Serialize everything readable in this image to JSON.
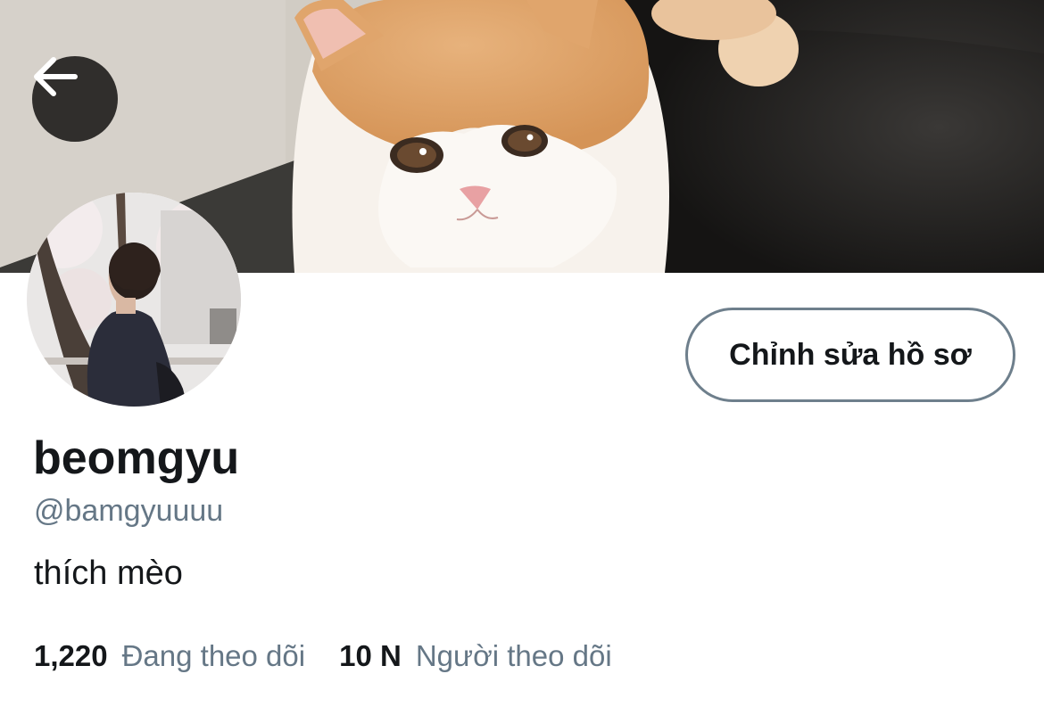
{
  "profile": {
    "display_name": "beomgyu",
    "handle": "@bamgyuuuu",
    "bio": "thích mèo",
    "edit_button_label": "Chỉnh sửa hồ sơ"
  },
  "stats": {
    "following_count": "1,220",
    "following_label": "Đang theo dõi",
    "followers_count": "10 N",
    "followers_label": "Người theo dõi"
  },
  "icons": {
    "back": "arrow-left-icon"
  },
  "colors": {
    "text_primary": "#14171a",
    "text_secondary": "#657786",
    "button_border": "#6e7f8c"
  }
}
